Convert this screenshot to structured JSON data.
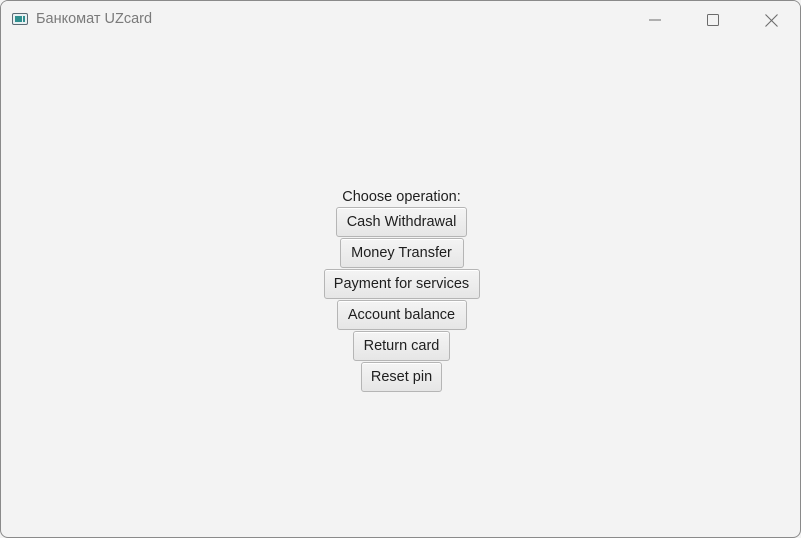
{
  "window": {
    "title": "Банкомат UZcard",
    "app_icon": "window-app-icon",
    "controls": {
      "minimize_icon": "minimize-icon",
      "maximize_icon": "maximize-icon",
      "close_icon": "close-icon"
    }
  },
  "main": {
    "prompt": "Choose operation:",
    "operations": [
      {
        "label": "Cash Withdrawal"
      },
      {
        "label": "Money Transfer"
      },
      {
        "label": "Payment for services"
      },
      {
        "label": "Account balance"
      },
      {
        "label": "Return card"
      },
      {
        "label": "Reset pin"
      }
    ]
  },
  "colors": {
    "background": "#f3f3f3",
    "button_face": "#ececec",
    "button_border": "#b5b5b5",
    "text": "#1e1e1e",
    "title_text": "#7a7a7a"
  }
}
